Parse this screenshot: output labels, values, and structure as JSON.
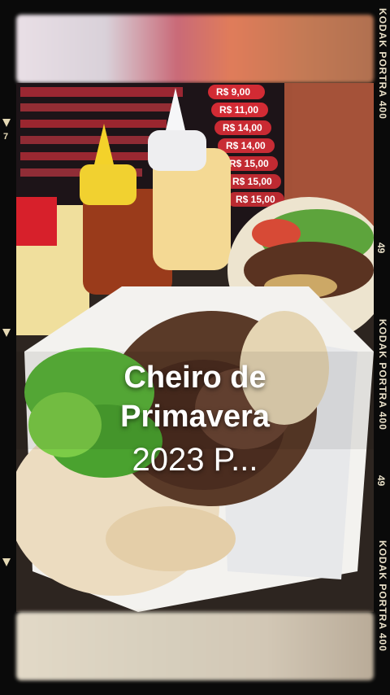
{
  "overlay": {
    "title_line1": "Cheiro de",
    "title_line2": "Primavera",
    "subtitle": "2023 P..."
  },
  "film": {
    "brand": "KODAK PORTRA 400",
    "frame_numbers": [
      "49",
      "49"
    ],
    "left_number": "7"
  },
  "menu_board": {
    "prices": [
      "R$ 9,00",
      "R$ 11,00",
      "R$ 14,00",
      "R$ 14,00",
      "R$ 15,00",
      "R$ 15,00",
      "R$ 15,00"
    ]
  }
}
